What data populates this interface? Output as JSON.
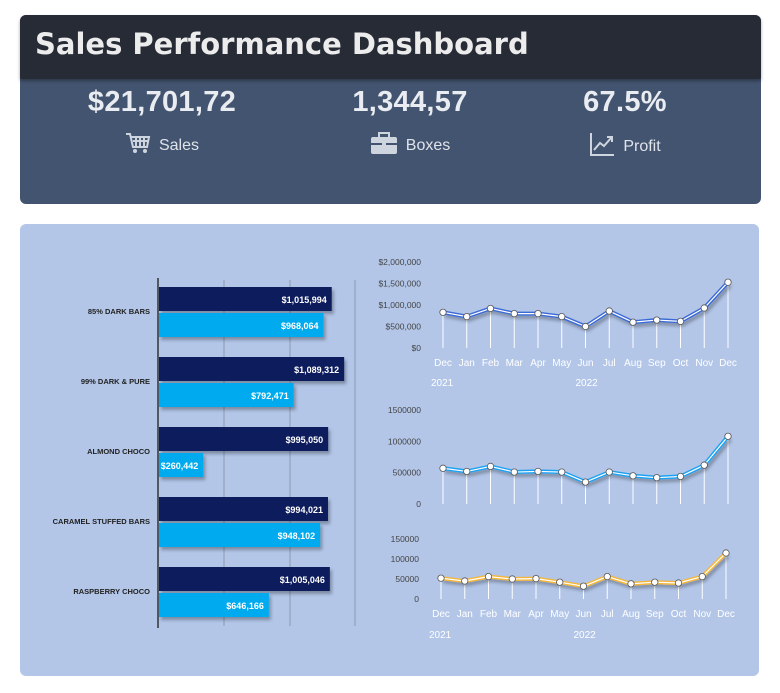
{
  "header": {
    "title": "Sales Performance Dashboard"
  },
  "kpis": [
    {
      "value": "$21,701,72",
      "label": "Sales",
      "icon": "shopping-cart-icon"
    },
    {
      "value": "1,344,57",
      "label": "Boxes",
      "icon": "briefcase-icon"
    },
    {
      "value": "67.5%",
      "label": "Profit",
      "icon": "trend-chart-icon"
    }
  ],
  "colors": {
    "dark_bar": "#0a1f5c",
    "light_bar": "#00aaef",
    "line1": "#3a6bd6",
    "line2": "#1da1f2",
    "line3": "#f4b73a",
    "panel": "#b3c6e8"
  },
  "chart_data": [
    {
      "type": "bar",
      "orientation": "horizontal",
      "categories": [
        "85% DARK BARS",
        "99% DARK & PURE",
        "ALMOND CHOCO",
        "CARAMEL STUFFED BARS",
        "RASPBERRY CHOCO"
      ],
      "series": [
        {
          "values": [
            1015994,
            1089312,
            995050,
            994021,
            1005046
          ],
          "labels": [
            "$1,015,994",
            "$1,089,312",
            "$995,050",
            "$994,021",
            "$1,005,046"
          ]
        },
        {
          "values": [
            968064,
            792471,
            260442,
            948102,
            646166
          ],
          "labels": [
            "$968,064",
            "$792,471",
            "$260,442",
            "$948,102",
            "$646,166"
          ]
        }
      ],
      "grid": true
    },
    {
      "type": "line",
      "x": [
        "Dec",
        "Jan",
        "Feb",
        "Mar",
        "Apr",
        "May",
        "Jun",
        "Jul",
        "Aug",
        "Sep",
        "Oct",
        "Nov",
        "Dec"
      ],
      "year_labels": [
        "2021",
        "2022"
      ],
      "values": [
        830000,
        730000,
        920000,
        800000,
        800000,
        730000,
        500000,
        860000,
        600000,
        650000,
        620000,
        930000,
        1530000
      ],
      "ylim": [
        0,
        2000000
      ],
      "yticks": [
        "$2,000,000",
        "$1,500,000",
        "$1,000,000",
        "$500,000",
        "$0"
      ]
    },
    {
      "type": "line",
      "values": [
        570000,
        520000,
        600000,
        510000,
        520000,
        510000,
        350000,
        510000,
        450000,
        420000,
        440000,
        620000,
        1080000
      ],
      "ylim": [
        0,
        1500000
      ],
      "yticks": [
        "1500000",
        "1000000",
        "500000",
        "0"
      ]
    },
    {
      "type": "line",
      "x": [
        "Dec",
        "Jan",
        "Feb",
        "Mar",
        "Apr",
        "May",
        "Jun",
        "Jul",
        "Aug",
        "Sep",
        "Oct",
        "Nov",
        "Dec"
      ],
      "year_labels": [
        "2021",
        "2022"
      ],
      "values": [
        52000,
        45000,
        56000,
        50000,
        51000,
        42000,
        32000,
        56000,
        38000,
        42000,
        40000,
        56000,
        115000
      ],
      "ylim": [
        0,
        150000
      ],
      "yticks": [
        "150000",
        "100000",
        "50000",
        "0"
      ]
    }
  ]
}
